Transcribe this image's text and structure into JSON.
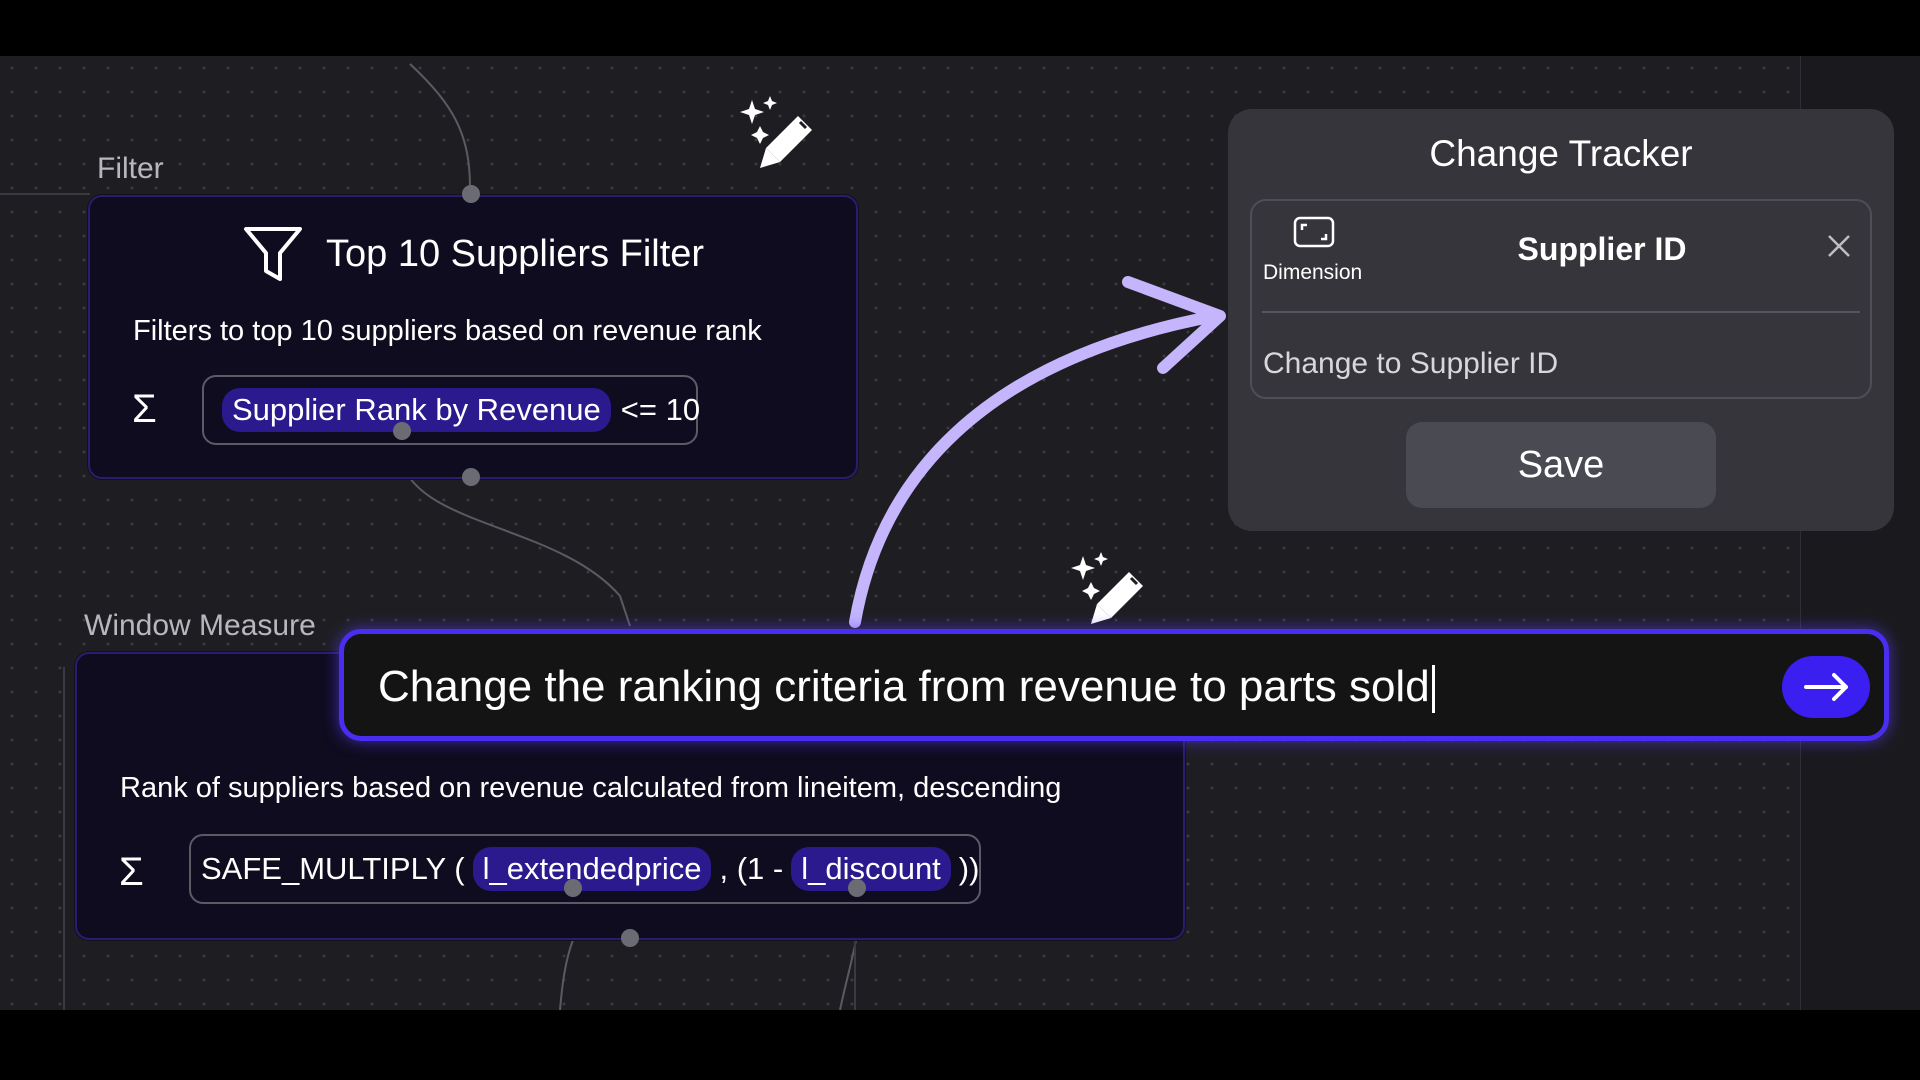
{
  "filter_node": {
    "section_label": "Filter",
    "title": "Top 10 Suppliers Filter",
    "description": "Filters to top 10 suppliers based on revenue rank",
    "sigma": "Σ",
    "expression": {
      "chip": "Supplier Rank by Revenue",
      "operator": "<= 10"
    }
  },
  "window_node": {
    "section_label": "Window Measure",
    "description": "Rank of suppliers based on revenue calculated from lineitem, descending",
    "sigma": "Σ",
    "expression": {
      "function": "SAFE_MULTIPLY (",
      "arg1": "l_extendedprice",
      "middle": ", (1 -",
      "arg2": "l_discount",
      "close": "))"
    }
  },
  "change_tracker": {
    "title": "Change Tracker",
    "item": {
      "type_label": "Dimension",
      "type_icon": "dimension-icon",
      "name": "Supplier ID",
      "change": "Change to Supplier ID"
    },
    "save_label": "Save"
  },
  "prompt": {
    "value": "Change the ranking criteria from revenue to parts sold",
    "send_icon": "arrow-right-icon"
  },
  "icons": [
    "magic-wand-icon",
    "funnel-icon",
    "close-icon",
    "curved-arrow-icon"
  ],
  "colors": {
    "accent": "#4a2ef0",
    "chip": "#2b1a8e",
    "node_bg": "#0f0c1f",
    "arrow": "#c4b5fd",
    "tracker_bg": "#35353b"
  }
}
